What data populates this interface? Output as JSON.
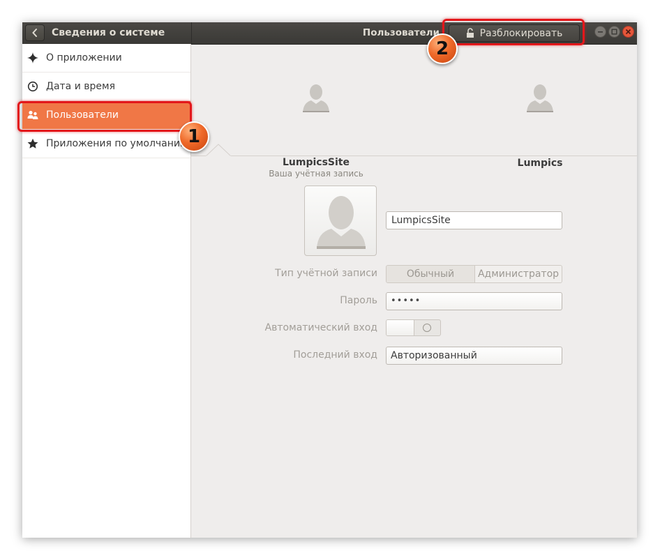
{
  "window": {
    "title": "Сведения о системе",
    "subtitle": "Пользователи",
    "unlock_label": "Разблокировать"
  },
  "sidebar": {
    "items": [
      {
        "label": "О приложении",
        "icon": "sparkle-icon"
      },
      {
        "label": "Дата и время",
        "icon": "clock-icon"
      },
      {
        "label": "Пользователи",
        "icon": "users-icon",
        "active": true
      },
      {
        "label": "Приложения по умолчанию",
        "icon": "star-icon"
      }
    ]
  },
  "users": [
    {
      "name": "LumpicsSite",
      "subtitle": "Ваша учётная запись"
    },
    {
      "name": "Lumpics",
      "subtitle": ""
    }
  ],
  "details": {
    "name_value": "LumpicsSite",
    "account_type_label": "Тип учётной записи",
    "account_type_options": [
      "Обычный",
      "Администратор"
    ],
    "password_label": "Пароль",
    "password_value": "•••••",
    "autologin_label": "Автоматический вход",
    "autologin_on": false,
    "last_login_label": "Последний вход",
    "last_login_value": "Авторизованный"
  },
  "annotations": {
    "badge_1": "1",
    "badge_2": "2",
    "color": "#e3171b"
  },
  "colors": {
    "accent": "#f07746",
    "headerbar": "#3e3d39"
  }
}
